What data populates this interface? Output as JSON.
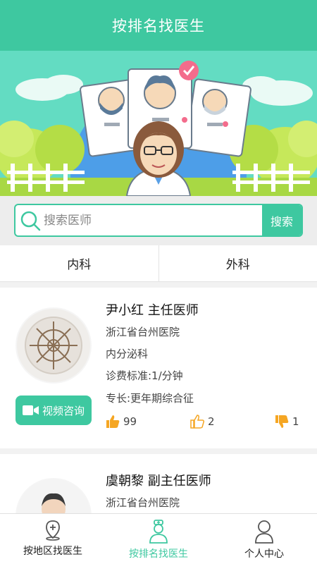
{
  "header": {
    "title": "按排名找医生"
  },
  "search": {
    "placeholder": "搜索医师",
    "button_label": "搜索"
  },
  "tabs": [
    {
      "label": "内科"
    },
    {
      "label": "外科"
    }
  ],
  "doctors": [
    {
      "name_title": "尹小红 主任医师",
      "hospital": "浙江省台州医院",
      "department": "内分泌科",
      "fee": "诊费标准:1/分钟",
      "specialty": "专长:更年期综合征",
      "video_label": "视频咨询",
      "likes": "99",
      "thumbs_up": "2",
      "thumbs_down": "1"
    },
    {
      "name_title": "虞朝黎 副主任医师",
      "hospital": "浙江省台州医院"
    }
  ],
  "bottom_nav": [
    {
      "label": "按地区找医生",
      "icon": "location-plus-icon"
    },
    {
      "label": "按排名找医生",
      "icon": "doctor-icon"
    },
    {
      "label": "个人中心",
      "icon": "person-icon"
    }
  ],
  "colors": {
    "accent": "#3ec8a0",
    "like": "#f5a623"
  }
}
